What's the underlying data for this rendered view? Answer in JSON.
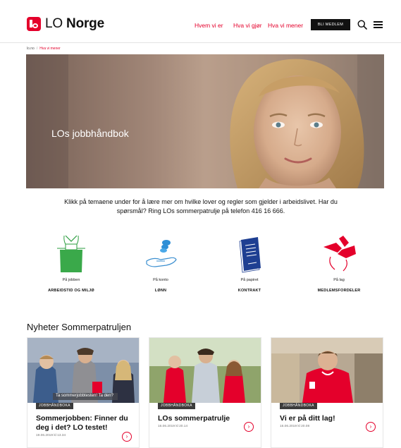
{
  "brand": {
    "lo": "LO",
    "norge": "Norge",
    "color": "#e4002b"
  },
  "nav": {
    "items": [
      "Hvem vi er",
      "Hva vi gjør",
      "Hva vi mener"
    ],
    "join_label": "BLI MEDLEM",
    "search_icon": "search-icon",
    "menu_icon": "hamburger-menu-icon"
  },
  "breadcrumb": {
    "home": "lo.no",
    "separator": "/",
    "current": "Hva vi mener"
  },
  "hero": {
    "title": "LOs jobbhåndbok"
  },
  "intro": {
    "text": "Klikk på temaene under for å lære mer om hvilke lover og regler som gjelder i arbeidslivet. Har du spørsmål? Ring LOs sommerpatrulje på telefon 416 16 666."
  },
  "categories": [
    {
      "sub": "På jobben",
      "title": "ARBEIDSTID OG MILJØ",
      "icon": "apron-icon"
    },
    {
      "sub": "På konto",
      "title": "LØNN",
      "icon": "coins-hand-icon"
    },
    {
      "sub": "På papiret",
      "title": "KONTRAKT",
      "icon": "contract-document-icon"
    },
    {
      "sub": "På lag",
      "title": "MEDLEMSFORDELER",
      "icon": "handshake-icon"
    }
  ],
  "news": {
    "heading": "Nyheter Sommerpatruljen",
    "cards": [
      {
        "tag": "JOBBHÅNDBOKA",
        "title": "Sommerjobben: Finner du deg i det? LO testet!",
        "date": "19.06.2019 kl 13.34",
        "overlay": "Ta sommerjobbtesten! Ta den?"
      },
      {
        "tag": "JOBBHÅNDBOKA",
        "title": "LOs sommerpatrulje",
        "date": "16.06.2019 kl 20.14"
      },
      {
        "tag": "JOBBHÅNDBOKA",
        "title": "Vi er på ditt lag!",
        "date": "16.06.2019 kl 20.08"
      }
    ]
  }
}
